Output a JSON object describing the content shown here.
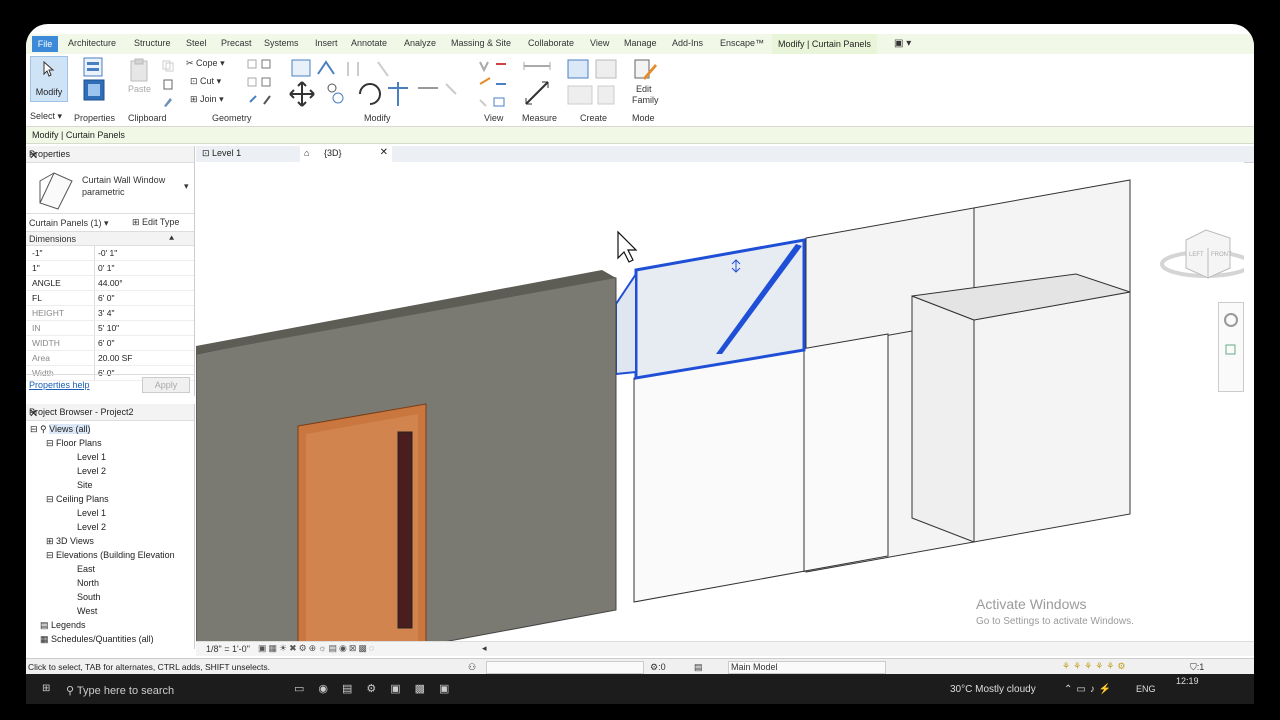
{
  "ribbon_tabs": [
    "File",
    "Architecture",
    "Structure",
    "Steel",
    "Precast",
    "Systems",
    "Insert",
    "Annotate",
    "Analyze",
    "Massing & Site",
    "Collaborate",
    "View",
    "Manage",
    "Add-Ins",
    "Enscape™",
    "Modify | Curtain Panels"
  ],
  "ribbon": {
    "modify_label": "Modify",
    "select_label": "Select",
    "properties_label": "Properties",
    "paste_label": "Paste",
    "cope_label": "Cope",
    "cut_label": "Cut",
    "join_label": "Join",
    "edit_family_line1": "Edit",
    "edit_family_line2": "Family",
    "panels": [
      "Clipboard",
      "Geometry",
      "Modify",
      "View",
      "Measure",
      "Create",
      "Mode"
    ]
  },
  "option_bar": {
    "context": "Modify | Curtain Panels"
  },
  "properties": {
    "header": "Properties",
    "type_line1": "Curtain Wall Window",
    "type_line2": "parametric",
    "selector": "Curtain Panels (1)",
    "edit_type": "Edit Type",
    "group": "Dimensions",
    "rows": [
      {
        "name": "-1\"",
        "value": "-0'  1\""
      },
      {
        "name": "1\"",
        "value": "0'  1\""
      },
      {
        "name": "ANGLE",
        "value": "44.00°"
      },
      {
        "name": "FL",
        "value": "6'  0\""
      },
      {
        "name": "HEIGHT",
        "value": "3'  4\""
      },
      {
        "name": "IN",
        "value": "5'  10\""
      },
      {
        "name": "WIDTH",
        "value": "6'  0\""
      },
      {
        "name": "Area",
        "value": "20.00 SF"
      },
      {
        "name": "Width",
        "value": "6'  0\""
      }
    ],
    "help": "Properties help",
    "apply": "Apply"
  },
  "project_browser": {
    "header": "Project Browser - Project2",
    "views_all": "Views (all)",
    "floor_plans": "Floor Plans",
    "fp_items": [
      "Level 1",
      "Level 2",
      "Site"
    ],
    "ceiling_plans": "Ceiling Plans",
    "cp_items": [
      "Level 1",
      "Level 2"
    ],
    "views_3d": "3D Views",
    "elevations": "Elevations (Building Elevation",
    "elev_items": [
      "East",
      "North",
      "South",
      "West"
    ],
    "legends": "Legends",
    "schedules": "Schedules/Quantities (all)"
  },
  "view_tabs": [
    {
      "label": "Level 1"
    },
    {
      "label": "{3D}"
    }
  ],
  "view_scale": "1/8\" = 1'-0\"",
  "viewcube": {
    "left": "LEFT",
    "front": "FRONT"
  },
  "status": {
    "message": "Click to select, TAB for alternates, CTRL adds, SHIFT unselects.",
    "zero": ":0",
    "model": "Main Model",
    "filter": ":1"
  },
  "watermark": {
    "title": "Activate Windows",
    "subtitle": "Go to Settings to activate Windows."
  },
  "taskbar": {
    "search": "Type here to search",
    "weather": "30°C  Mostly cloudy",
    "lang": "ENG",
    "time": "12:19"
  },
  "colors": {
    "file_tab": "#3c8ad8",
    "selection": "#1f4fd6",
    "contextual": "#e9f5d8",
    "door": "#c9773f"
  }
}
